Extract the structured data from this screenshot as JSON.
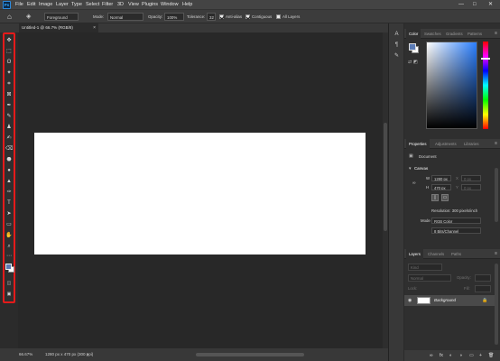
{
  "app": {
    "logo_text": "Ps"
  },
  "menu": [
    "File",
    "Edit",
    "Image",
    "Layer",
    "Type",
    "Select",
    "Filter",
    "3D",
    "View",
    "Plugins",
    "Window",
    "Help"
  ],
  "window_controls": {
    "minimize": "—",
    "maximize": "□",
    "close": "✕"
  },
  "options_bar": {
    "home_icon": "⌂",
    "tool_icon": "◈",
    "fill_source": "Foreground",
    "mode_label": "Mode:",
    "mode_value": "Normal",
    "opacity_label": "Opacity:",
    "opacity_value": "100%",
    "tolerance_label": "Tolerance:",
    "tolerance_value": "32",
    "anti_alias_label": "Anti-alias",
    "contiguous_label": "Contiguous",
    "all_layers_label": "All Layers"
  },
  "document": {
    "tab_title": "Untitled-1 @ 66.7% (RGB/8)",
    "close": "×"
  },
  "status": {
    "zoom": "66.67%",
    "dimensions": "1280 px x 470 px (300 ppi)",
    "arrow": "›"
  },
  "tools": [
    "✥",
    "⬚",
    "ʘ",
    "✦",
    "⌗",
    "⊠",
    "✒",
    "✎",
    "♟",
    "✍",
    "⌫",
    "⬣",
    "●",
    "▲",
    "✑",
    "T",
    "➤",
    "▭",
    "✋",
    "⌕",
    "⋯"
  ],
  "color_panel": {
    "tabs": [
      "Color",
      "Swatches",
      "Gradients",
      "Patterns"
    ],
    "menu": "≡"
  },
  "properties_panel": {
    "tabs": [
      "Properties",
      "Adjustments",
      "Libraries"
    ],
    "menu": "≡",
    "section": "Document",
    "canvas_heading": "Canvas",
    "w_label": "W",
    "w_value": "1280 px",
    "x_label": "X",
    "x_value": "0 px",
    "h_label": "H",
    "h_value": "470 px",
    "y_label": "Y",
    "y_value": "0 px",
    "resolution": "Resolution: 300 pixels/inch",
    "mode_label": "Mode",
    "mode_value": "RGB Color",
    "bits_value": "8 Bits/Channel"
  },
  "layers_panel": {
    "tabs": [
      "Layers",
      "Channels",
      "Paths"
    ],
    "menu": "≡",
    "kind": "Kind",
    "blend": "Normal",
    "opacity_label": "Opacity:",
    "lock_label": "Lock:",
    "fill_label": "Fill:",
    "layer_name": "Background",
    "footer_icons": [
      "∞",
      "fx",
      "◐",
      "◑",
      "▭",
      "+",
      "🗑"
    ]
  },
  "colors": {
    "foreground": "#5b7bb6",
    "background": "#ffffff",
    "highlight": "#e51a1a"
  }
}
